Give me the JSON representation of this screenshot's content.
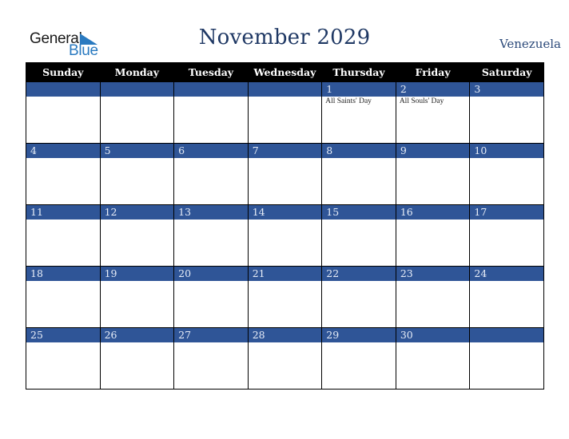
{
  "logo": {
    "line1": "General",
    "line2": "Blue",
    "accent_color": "#2a7ac0"
  },
  "header": {
    "title": "November 2029",
    "country": "Venezuela"
  },
  "colors": {
    "header_bg": "#000000",
    "date_strip_bg": "#2f5597",
    "title_color": "#1f3864"
  },
  "weekdays": [
    "Sunday",
    "Monday",
    "Tuesday",
    "Wednesday",
    "Thursday",
    "Friday",
    "Saturday"
  ],
  "weeks": [
    {
      "days": [
        {
          "num": "",
          "event": ""
        },
        {
          "num": "",
          "event": ""
        },
        {
          "num": "",
          "event": ""
        },
        {
          "num": "",
          "event": ""
        },
        {
          "num": "1",
          "event": "All Saints' Day"
        },
        {
          "num": "2",
          "event": "All Souls' Day"
        },
        {
          "num": "3",
          "event": ""
        }
      ]
    },
    {
      "days": [
        {
          "num": "4",
          "event": ""
        },
        {
          "num": "5",
          "event": ""
        },
        {
          "num": "6",
          "event": ""
        },
        {
          "num": "7",
          "event": ""
        },
        {
          "num": "8",
          "event": ""
        },
        {
          "num": "9",
          "event": ""
        },
        {
          "num": "10",
          "event": ""
        }
      ]
    },
    {
      "days": [
        {
          "num": "11",
          "event": ""
        },
        {
          "num": "12",
          "event": ""
        },
        {
          "num": "13",
          "event": ""
        },
        {
          "num": "14",
          "event": ""
        },
        {
          "num": "15",
          "event": ""
        },
        {
          "num": "16",
          "event": ""
        },
        {
          "num": "17",
          "event": ""
        }
      ]
    },
    {
      "days": [
        {
          "num": "18",
          "event": ""
        },
        {
          "num": "19",
          "event": ""
        },
        {
          "num": "20",
          "event": ""
        },
        {
          "num": "21",
          "event": ""
        },
        {
          "num": "22",
          "event": ""
        },
        {
          "num": "23",
          "event": ""
        },
        {
          "num": "24",
          "event": ""
        }
      ]
    },
    {
      "days": [
        {
          "num": "25",
          "event": ""
        },
        {
          "num": "26",
          "event": ""
        },
        {
          "num": "27",
          "event": ""
        },
        {
          "num": "28",
          "event": ""
        },
        {
          "num": "29",
          "event": ""
        },
        {
          "num": "30",
          "event": ""
        },
        {
          "num": "",
          "event": ""
        }
      ]
    }
  ]
}
